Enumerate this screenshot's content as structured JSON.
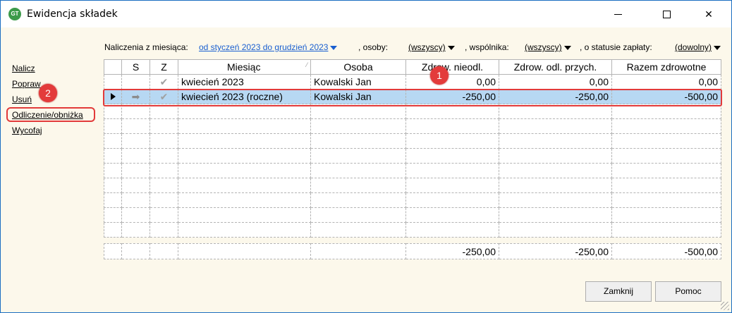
{
  "window": {
    "title": "Ewidencja składek",
    "icon_label": "GT"
  },
  "filters": {
    "prefix": "Naliczenia z miesiąca:",
    "range": "od styczeń 2023 do grudzień 2023",
    "osoby_label": ", osoby:",
    "osoby_value": "(wszyscy)",
    "wspolnika_label": ", wspólnika:",
    "wspolnika_value": "(wszyscy)",
    "status_label": ", o statusie zapłaty:",
    "status_value": "(dowolny)"
  },
  "sidebar": {
    "items": [
      {
        "label": "Nalicz"
      },
      {
        "label": "Popraw"
      },
      {
        "label": "Usuń"
      },
      {
        "label": "Odliczenie/obniżka"
      },
      {
        "label": "Wycofaj"
      }
    ]
  },
  "table": {
    "columns": [
      "",
      "S",
      "Z",
      "Miesiąc",
      "Osoba",
      "Zdrow. nieodl.",
      "Zdrow. odl. przych.",
      "Razem zdrowotne"
    ],
    "rows": [
      {
        "indicator": "",
        "s": "",
        "z": "✔",
        "miesiac": "kwiecień 2023",
        "osoba": "Kowalski Jan",
        "zdrow_nieodl": "0,00",
        "zdrow_odl": "0,00",
        "razem": "0,00",
        "selected": false
      },
      {
        "indicator": "▶",
        "s": "➡",
        "z": "✔",
        "miesiac": "kwiecień 2023 (roczne)",
        "osoba": "Kowalski Jan",
        "zdrow_nieodl": "-250,00",
        "zdrow_odl": "-250,00",
        "razem": "-500,00",
        "selected": true
      }
    ],
    "empty_rows": 9
  },
  "totals": {
    "zdrow_nieodl": "-250,00",
    "zdrow_odl": "-250,00",
    "razem": "-500,00"
  },
  "annotations": {
    "badge1": "1",
    "badge2": "2"
  },
  "buttons": {
    "close_label": "Zamknij",
    "help_label": "Pomoc"
  },
  "colors": {
    "selection": "#b7d8f3",
    "highlight_red": "#e23a3a",
    "link_blue": "#1a5fd0"
  }
}
